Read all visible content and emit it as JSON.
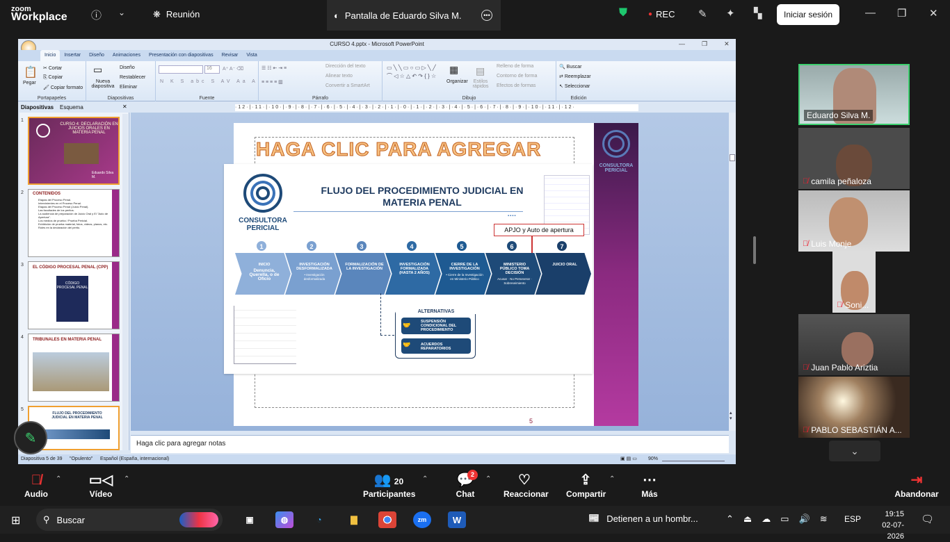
{
  "zoom": {
    "logo_line1": "zoom",
    "logo_line2": "Workplace",
    "meeting_label": "Reunión",
    "share_tab_label": "Pantalla de Eduardo Silva M.",
    "rec_label": "REC",
    "signin_label": "Iniciar sesión"
  },
  "ppt": {
    "window_title": "CURSO 4.pptx - Microsoft PowerPoint",
    "tabs": [
      "Inicio",
      "Insertar",
      "Diseño",
      "Animaciones",
      "Presentación con diapositivas",
      "Revisar",
      "Vista"
    ],
    "groups": {
      "portapapeles": {
        "label": "Portapapeles",
        "paste": "Pegar",
        "cut": "Cortar",
        "copy": "Copiar",
        "format": "Copiar formato"
      },
      "diapositivas": {
        "label": "Diapositivas",
        "new": "Nueva diapositiva",
        "layout": "Diseño",
        "reset": "Restablecer",
        "delete": "Eliminar"
      },
      "fuente": {
        "label": "Fuente",
        "size": "16"
      },
      "parrafo": {
        "label": "Párrafo",
        "dir": "Dirección del texto",
        "align": "Alinear texto",
        "smartart": "Convertir a SmartArt"
      },
      "dibujo": {
        "label": "Dibujo",
        "arrange": "Organizar",
        "styles": "Estilos rápidos",
        "fill": "Relleno de forma",
        "outline": "Contorno de forma",
        "effects": "Efectos de formas"
      },
      "edicion": {
        "label": "Edición",
        "find": "Buscar",
        "replace": "Reemplazar",
        "select": "Seleccionar"
      }
    },
    "ruler_text": "·12·|·11·|·10·|·9·|·8·|·7·|·6·|·5·|·4·|·3·|·2·|·1·|·0·|·1·|·2·|·3·|·4·|·5·|·6·|·7·|·8·|·9·|·10·|·11·|·12·",
    "panel_tabs": {
      "slides": "Diapositivas",
      "outline": "Esquema"
    },
    "thumbs": [
      {
        "num": "1",
        "title": "CURSO 4: DECLARACIÓN EN JUICIOS ORALES EN MATERIA PENAL",
        "sub": "Eduardo Silva M."
      },
      {
        "num": "2",
        "title": "CONTENIDOS",
        "lines": [
          "Etapas del Proceso Penal.",
          "Intervinientes en el Proceso Penal.",
          "Etapas del Proceso Penal (Juicio Penal).",
          "Las facultades de los peritos.",
          "La audiencia de preparación de Juicio Oral y El \"Auto de Apertura\".",
          "Los medios de prueba / Prueba Pericial.",
          "Exhibición de prueba material, fotos, videos, planos, etc.",
          "Roles en la declaración del perito."
        ]
      },
      {
        "num": "3",
        "title": "EL CÓDIGO PROCESAL PENAL (CPP)",
        "book": "CÓDIGO PROCESAL PENAL"
      },
      {
        "num": "4",
        "title": "TRIBUNALES EN MATERIA PENAL"
      },
      {
        "num": "5",
        "title": "FLUJO DEL PROCEDIMIENTO JUDICIAL EN MATERIA PENAL"
      }
    ],
    "slide": {
      "placeholder_title": "HAGA CLIC PARA AGREGAR",
      "brand_side": "CONSULTORA PERICIAL",
      "brand_main": "CONSULTORA PERICIAL",
      "main_title": "FLUJO DEL PROCEDIMIENTO JUDICIAL EN MATERIA PENAL",
      "callout": "APJO y Auto de apertura",
      "steps": [
        {
          "n": "1",
          "title": "INICIO",
          "sub": "Denuncia, Querella, o de Oficio"
        },
        {
          "n": "2",
          "title": "INVESTIGACIÓN DESFORMALIZADA",
          "sub": "• Investigación desformalizada"
        },
        {
          "n": "3",
          "title": "FORMALIZACIÓN DE LA INVESTIGACIÓN",
          "sub": ""
        },
        {
          "n": "4",
          "title": "INVESTIGACIÓN FORMALIZADA (HASTA 2 AÑOS)",
          "sub": ""
        },
        {
          "n": "5",
          "title": "CIERRE DE LA INVESTIGACIÓN",
          "sub": "• Cierre de la Investigación en Ministerio Público"
        },
        {
          "n": "6",
          "title": "MINISTERIO PÚBLICO TOMA DECISIÓN",
          "sub": "Acusar · No Perseverar · Sobreseimiento"
        },
        {
          "n": "7",
          "title": "JUICIO ORAL",
          "sub": ""
        }
      ],
      "alternatives_title": "ALTERNATIVAS",
      "alt1": "SUSPENSIÓN CONDICIONAL DEL PROCEDIMIENTO",
      "alt2": "ACUERDOS REPARATORIOS",
      "page_number": "5"
    },
    "notes_placeholder": "Haga clic para agregar notas",
    "status": {
      "slide_of": "Diapositiva 5 de 39",
      "theme": "\"Opulento\"",
      "lang": "Español (España, internacional)",
      "zoom": "90%"
    }
  },
  "participants": [
    {
      "name": "Eduardo Silva M.",
      "muted": false,
      "active": true
    },
    {
      "name": "camila peñaloza",
      "muted": true
    },
    {
      "name": "Luis Monje",
      "muted": true
    },
    {
      "name": "Soni...",
      "muted": true
    },
    {
      "name": "Juan Pablo Ariztia",
      "muted": true
    },
    {
      "name": "PABLO SEBASTIÁN A...",
      "muted": true
    }
  ],
  "toolbar": {
    "audio": "Audio",
    "video": "Vídeo",
    "participants": "Participantes",
    "participants_count": "20",
    "chat": "Chat",
    "chat_badge": "2",
    "react": "Reaccionar",
    "share": "Compartir",
    "more": "Más",
    "leave": "Abandonar"
  },
  "taskbar": {
    "search_label": "Buscar",
    "news": "Detienen a un hombr...",
    "lang": "ESP",
    "time": "19:15",
    "date": "02-07-2026"
  }
}
